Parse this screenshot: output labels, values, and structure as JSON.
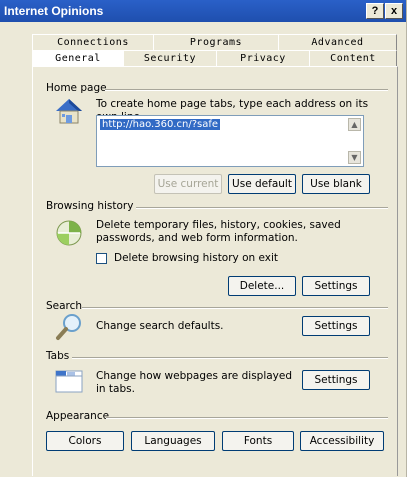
{
  "window": {
    "title": "Internet Opinions",
    "help": "?",
    "close": "x"
  },
  "tabs": {
    "row1": [
      "Connections",
      "Programs",
      "Advanced"
    ],
    "row2": [
      "General",
      "Security",
      "Privacy",
      "Content"
    ],
    "selected": "General"
  },
  "home_page": {
    "label": "Home page",
    "instruction": "To create home page tabs, type each address on its own line.",
    "url": "http://hao.360.cn/?safe",
    "buttons": {
      "use_current": "Use current",
      "use_default": "Use default",
      "use_blank": "Use blank"
    }
  },
  "browsing_history": {
    "label": "Browsing history",
    "description": "Delete temporary files, history, cookies, saved passwords, and web form information.",
    "checkbox_label": "Delete browsing history on exit",
    "checkbox_checked": false,
    "buttons": {
      "delete": "Delete...",
      "settings": "Settings"
    }
  },
  "search": {
    "label": "Search",
    "description": "Change search defaults.",
    "settings": "Settings"
  },
  "tabs_section": {
    "label": "Tabs",
    "description": "Change how webpages are displayed in tabs.",
    "settings": "Settings"
  },
  "appearance": {
    "label": "Appearance",
    "buttons": {
      "colors": "Colors",
      "languages": "Languages",
      "fonts": "Fonts",
      "accessibility": "Accessibility"
    }
  },
  "icons": [
    "house-icon",
    "eraser-icon",
    "magnifier-icon",
    "tabs-window-icon"
  ]
}
